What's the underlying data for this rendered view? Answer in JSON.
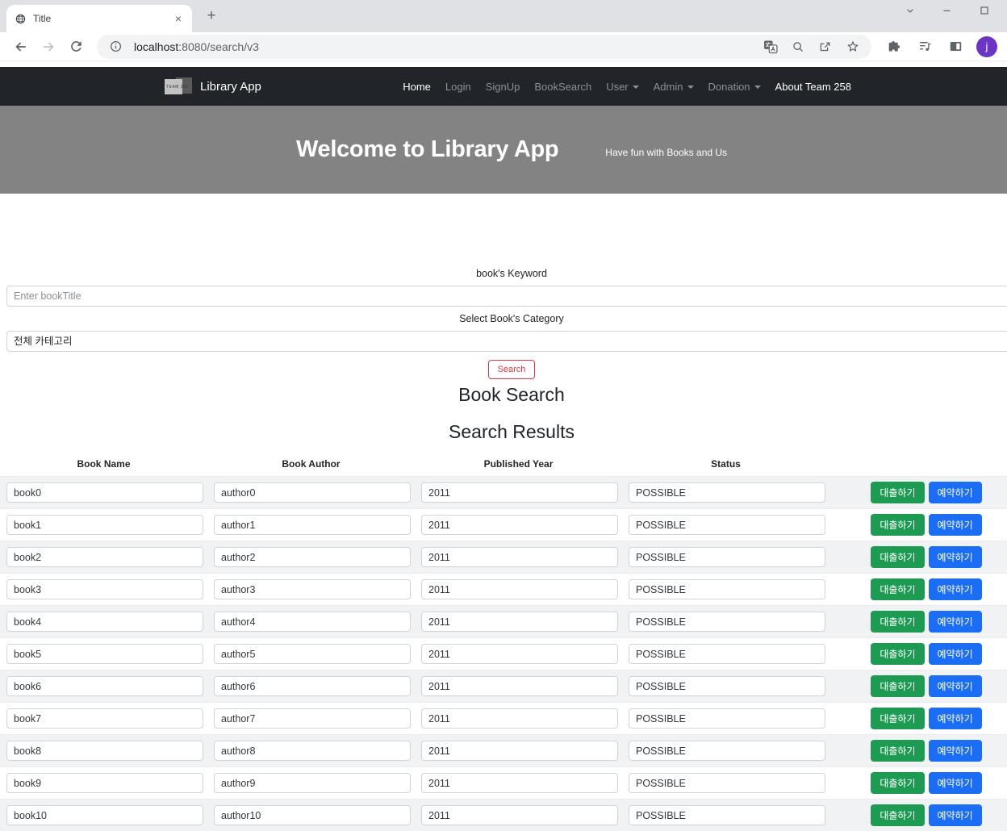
{
  "browser": {
    "tab": {
      "title": "Title"
    },
    "url": {
      "host": "localhost",
      "rest": ":8080/search/v3"
    },
    "profile_initial": "j"
  },
  "navbar": {
    "brand": "Library App",
    "logo_text": "TEAM 258",
    "items": [
      {
        "label": "Home",
        "active": true,
        "dropdown": false
      },
      {
        "label": "Login",
        "active": false,
        "dropdown": false
      },
      {
        "label": "SignUp",
        "active": false,
        "dropdown": false
      },
      {
        "label": "BookSearch",
        "active": false,
        "dropdown": false
      },
      {
        "label": "User",
        "active": false,
        "dropdown": true
      },
      {
        "label": "Admin",
        "active": false,
        "dropdown": true
      },
      {
        "label": "Donation",
        "active": false,
        "dropdown": true
      },
      {
        "label": "About Team 258",
        "active": true,
        "dropdown": false
      }
    ]
  },
  "hero": {
    "title": "Welcome to Library App",
    "subtitle": "Have fun with Books and Us"
  },
  "search_form": {
    "keyword_label": "book's Keyword",
    "keyword_placeholder": "Enter bookTitle",
    "category_label": "Select Book's Category",
    "category_value": "전체 카테고리",
    "search_button": "Search"
  },
  "headings": {
    "main": "Book Search",
    "sub": "Search Results"
  },
  "results": {
    "columns": [
      "Book Name",
      "Book Author",
      "Published Year",
      "Status"
    ],
    "borrow_label": "대출하기",
    "reserve_label": "예약하기",
    "rows": [
      {
        "name": "book0",
        "author": "author0",
        "year": "2011",
        "status": "POSSIBLE"
      },
      {
        "name": "book1",
        "author": "author1",
        "year": "2011",
        "status": "POSSIBLE"
      },
      {
        "name": "book2",
        "author": "author2",
        "year": "2011",
        "status": "POSSIBLE"
      },
      {
        "name": "book3",
        "author": "author3",
        "year": "2011",
        "status": "POSSIBLE"
      },
      {
        "name": "book4",
        "author": "author4",
        "year": "2011",
        "status": "POSSIBLE"
      },
      {
        "name": "book5",
        "author": "author5",
        "year": "2011",
        "status": "POSSIBLE"
      },
      {
        "name": "book6",
        "author": "author6",
        "year": "2011",
        "status": "POSSIBLE"
      },
      {
        "name": "book7",
        "author": "author7",
        "year": "2011",
        "status": "POSSIBLE"
      },
      {
        "name": "book8",
        "author": "author8",
        "year": "2011",
        "status": "POSSIBLE"
      },
      {
        "name": "book9",
        "author": "author9",
        "year": "2011",
        "status": "POSSIBLE"
      },
      {
        "name": "book10",
        "author": "author10",
        "year": "2011",
        "status": "POSSIBLE"
      }
    ]
  },
  "icons": {
    "tab_close": "×",
    "new_tab": "+"
  },
  "colors": {
    "navbar_bg": "#212529",
    "hero_bg": "#838383",
    "green": "#1e9b53",
    "blue": "#1b6ef3",
    "danger": "#dc3545",
    "stripe": "#f1f2f3"
  }
}
